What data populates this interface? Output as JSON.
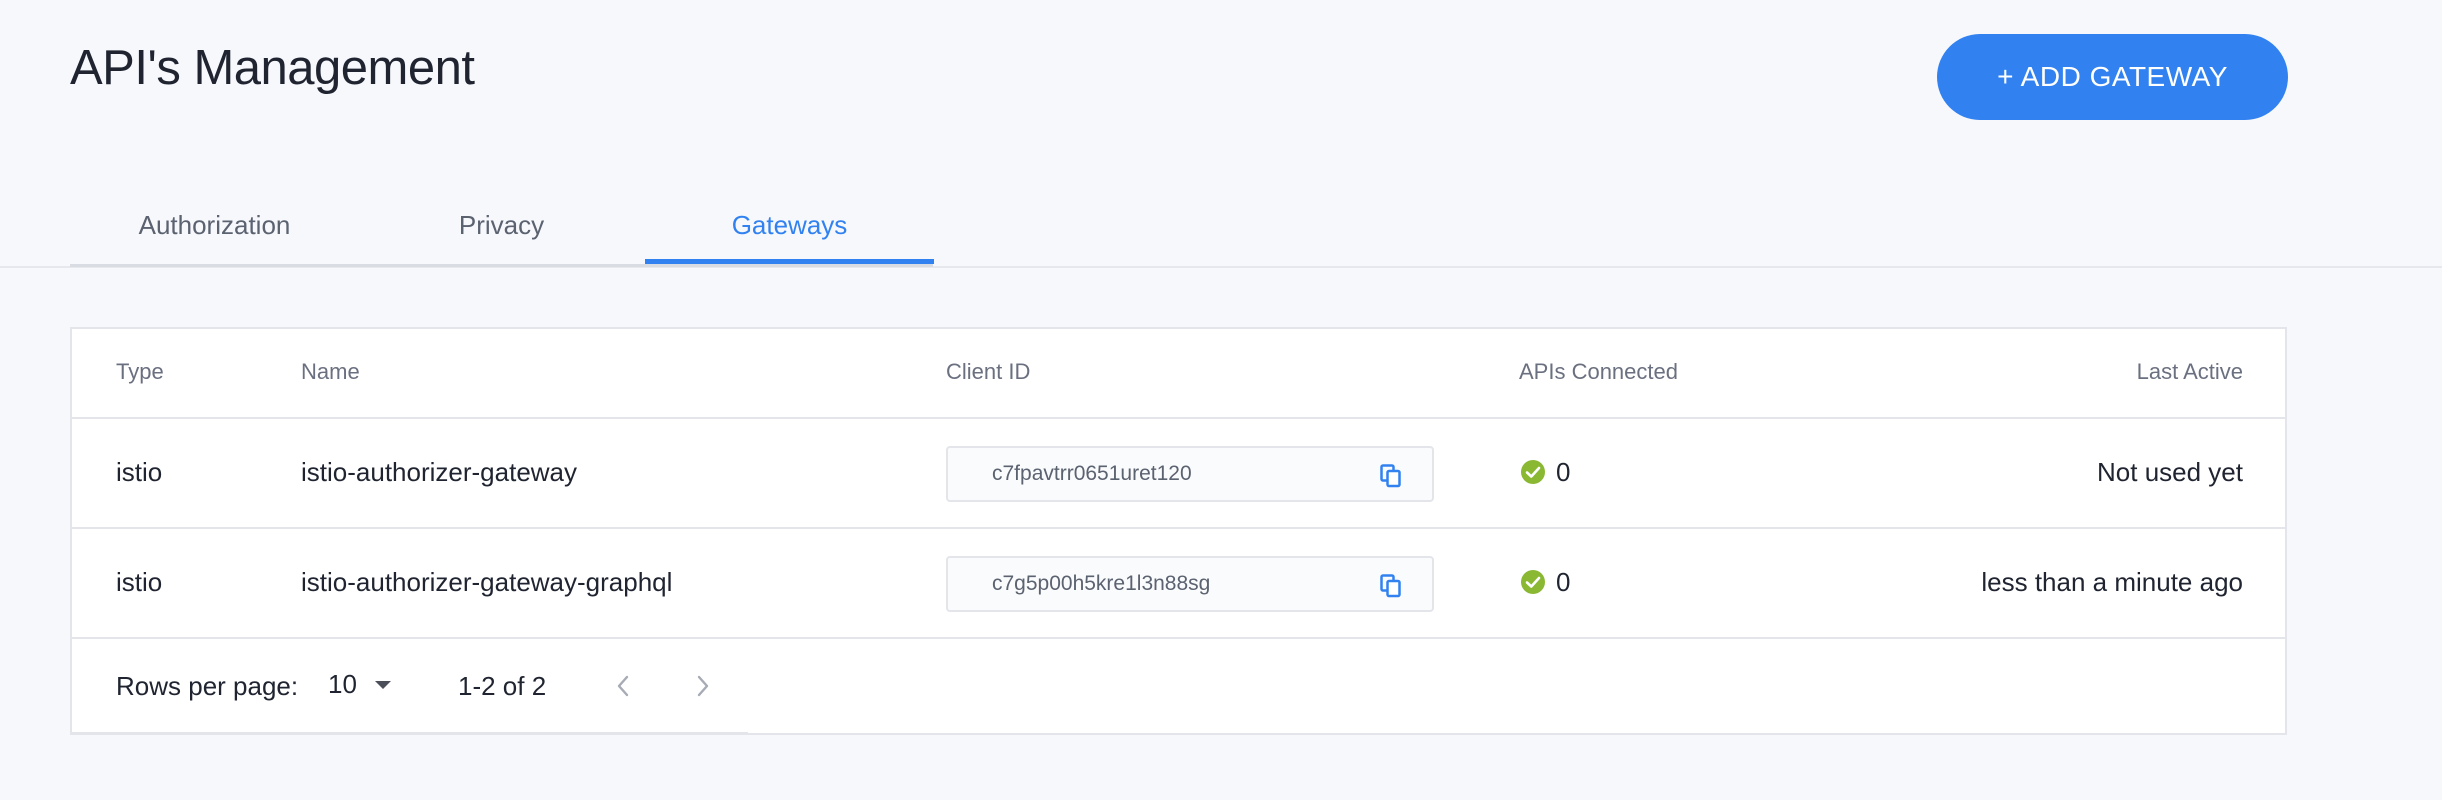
{
  "page": {
    "title": "API's Management"
  },
  "header": {
    "add_button_label": "+ ADD GATEWAY"
  },
  "tabs": [
    {
      "label": "Authorization",
      "active": false
    },
    {
      "label": "Privacy",
      "active": false
    },
    {
      "label": "Gateways",
      "active": true
    }
  ],
  "table": {
    "columns": [
      "Type",
      "Name",
      "Client ID",
      "APIs Connected",
      "Last Active"
    ],
    "rows": [
      {
        "type": "istio",
        "name": "istio-authorizer-gateway",
        "client_id": "c7fpavtrr0651uret120",
        "apis_connected": "0",
        "last_active": "Not used yet"
      },
      {
        "type": "istio",
        "name": "istio-authorizer-gateway-graphql",
        "client_id": "c7g5p00h5kre1l3n88sg",
        "apis_connected": "0",
        "last_active": "less than a minute ago"
      }
    ]
  },
  "pagination": {
    "rows_per_page_label": "Rows per page:",
    "rows_per_page_value": "10",
    "range_text": "1-2 of 2"
  },
  "colors": {
    "accent": "#3182f0",
    "success": "#8ab833",
    "background": "#f7f8fc"
  },
  "icons": {
    "copy": "copy-icon",
    "status": "check-circle-icon",
    "prev": "chevron-left-icon",
    "next": "chevron-right-icon",
    "dropdown": "caret-down-icon"
  }
}
